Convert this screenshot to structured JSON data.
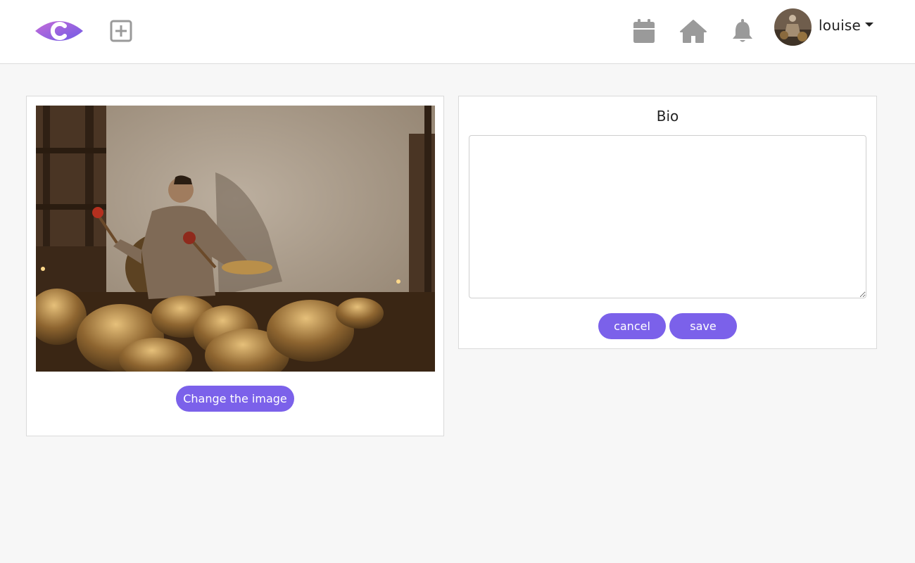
{
  "header": {
    "logo_icon": "brand-eye-c-logo",
    "add_icon": "plus-square-icon",
    "nav_icons": [
      "calendar-icon",
      "home-icon",
      "bell-icon"
    ],
    "user": {
      "name": "louise",
      "avatar_icon": "user-avatar-photo"
    }
  },
  "image_panel": {
    "photo": "man-playing-singing-bowls-photo",
    "change_button_label": "Change the image"
  },
  "bio_panel": {
    "title": "Bio",
    "textarea_value": "",
    "cancel_label": "cancel",
    "save_label": "save"
  },
  "colors": {
    "accent": "#7b61ea",
    "icon_gray": "#9a9a9a",
    "page_bg": "#f7f7f7"
  }
}
